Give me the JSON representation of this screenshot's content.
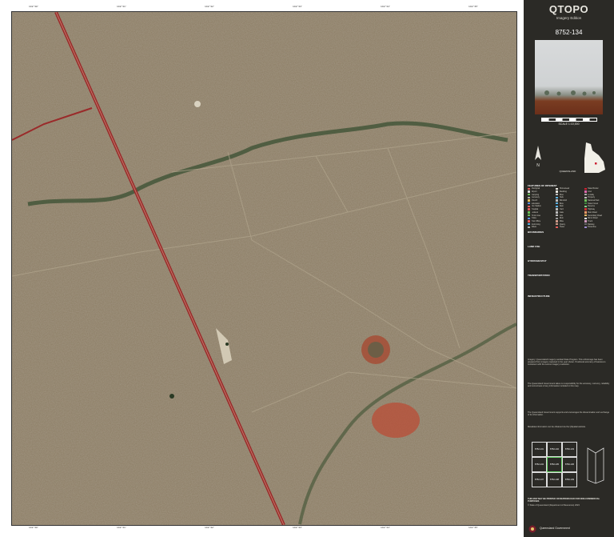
{
  "map": {
    "sheet_number": "8752-134",
    "top_ticks": [
      "148°30'",
      "148°31'",
      "148°32'",
      "148°33'",
      "148°34'",
      "148°35'"
    ],
    "bottom_ticks": [
      "148°30'",
      "148°31'",
      "148°32'",
      "148°33'",
      "148°34'",
      "148°35'"
    ]
  },
  "panel": {
    "title": "QTOPO",
    "subtitle": "Imagery Edition",
    "sheet_id": "8752-134",
    "scale_label": "SCALE 1:10,000",
    "state_caption": "QUEENSLAND",
    "legend_heading_features": "FEATURES OF INTEREST",
    "legend_heading_boundaries": "BOUNDARIES",
    "legend_heading_landuse": "LAND USE",
    "legend_heading_hydro": "HYDROGRAPHY",
    "legend_heading_transport": "TRANSPORTATION",
    "legend_heading_infra": "INFRASTRUCTURE",
    "legend_items_a": [
      "Aboriginal",
      "Airport",
      "Camping",
      "Cemetery",
      "Church",
      "Education",
      "Fire Station",
      "Hospital",
      "Lookout",
      "Picnic Area",
      "Police",
      "Post Office",
      "Swimming",
      "Toilets"
    ],
    "legend_items_b": [
      "Homestead",
      "Dwelling",
      "Shed",
      "Tank",
      "Windmill",
      "Bore",
      "Dam",
      "Yard",
      "Gate",
      "Grid",
      "Ruin",
      "Mine",
      "Quarry",
      "Tower"
    ],
    "legend_items_c": [
      "State Border",
      "LGA",
      "Locality",
      "Property",
      "National Park",
      "State Forest",
      "Reserve",
      "Highway",
      "Main Road",
      "Secondary Road",
      "Minor Road",
      "Track",
      "Railway",
      "Powerline"
    ],
    "para_1": "Imagery: Queensland Imagery Landsat State Program. This orthoimage has been prepared from imagery captured in the year shown. Positional accuracy of features is consistent with the source imagery resolution.",
    "para_2": "The Queensland Government takes no responsibility for the accuracy, currency, reliability and correctness of any information included in this map.",
    "para_3": "The Queensland Government supports and encourages the dissemination and exchange of its information.",
    "para_4": "Metadata information can be obtained via the QSpatial website.",
    "para_5": "THIS MAP MAY BE PRINTED OR REPRODUCED FOR NON-COMMERCIAL PURPOSES",
    "para_6": "© State of Queensland (Department of Resources) 2023",
    "index_cells": [
      "8752-131",
      "8752-132",
      "8752-133",
      "8752-134",
      "8752-135",
      "8752-136",
      "8752-137",
      "8752-138",
      "8752-139"
    ],
    "footer": "Queensland Government"
  },
  "colors": {
    "panel_bg": "#2b2a26",
    "terrain": "#8a7a62",
    "road_red": "#9a2a2a",
    "vegetation": "#3c5a34",
    "red_soil": "#b8503a"
  }
}
